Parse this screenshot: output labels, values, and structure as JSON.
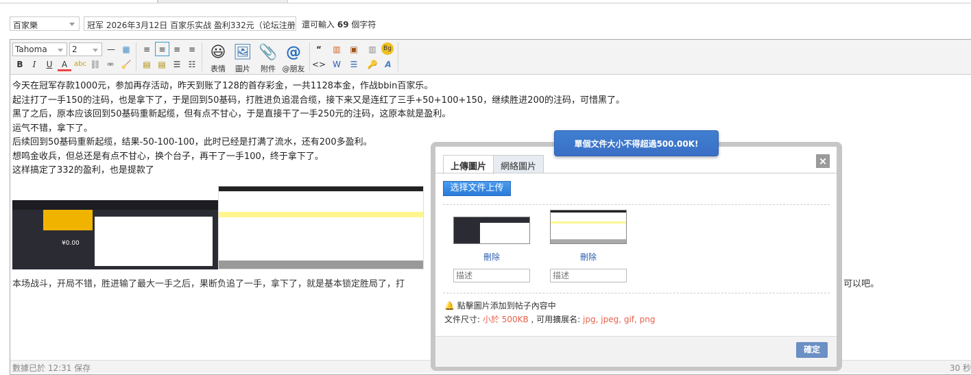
{
  "form": {
    "category": "百家樂",
    "title_value": "冠军 2026年3月12日 百家乐实战 盈利332元（论坛注册）",
    "counter_prefix": "還可輸入",
    "counter_num": "69",
    "counter_suffix": "個字符"
  },
  "toolbar": {
    "font": "Tahoma",
    "size": "2",
    "emoji": "表情",
    "image": "圖片",
    "attach": "附件",
    "at": "@朋友"
  },
  "content": {
    "paragraphs": [
      "今天在冠军存款1000元，参加再存活动，昨天到账了128的首存彩金，一共1128本金，作战bbin百家乐。",
      "起注打了一手150的注码，也是拿下了，于是回到50基码，打胜进负追混合缆，接下来又是连红了三手+50+100+150，继续胜进200的注码，可惜黑了。",
      "黑了之后，原本应该回到50基码重新起缆，但有点不甘心，于是直接干了一手250元的注码，这原本就是盈利。",
      "运气不错，拿下了。",
      "后续回到50基码重新起缆，结果-50-100-100，此时已经是打满了流水，还有200多盈利。",
      "想鸣金收兵，但总还是有点不甘心，换个台子，再干了一手100，终于拿下了。",
      "这样搞定了332的盈利，也是提款了"
    ],
    "last_left": "本场战斗，开局不错，胜进输了最大一手之后，果断负追了一手，拿下了，就是基本锁定胜局了，打",
    "last_right": "可以吧。",
    "img1_balance": "¥0.00"
  },
  "status": {
    "saved": "數據已於 12:31 保存",
    "right": "30 秒"
  },
  "dialog": {
    "toast": "單個文件大小不得超過500.00K!",
    "tab_upload": "上傳圖片",
    "tab_web": "網絡圖片",
    "close": "×",
    "upload_btn": "选择文件上传",
    "delete": "刪除",
    "desc_placeholder": "描述",
    "hint": "點擊圖片添加到帖子內容中",
    "size_label": "文件尺寸:",
    "size_value": "小於 500KB",
    "ext_label": ", 可用擴展名:",
    "ext_value": "jpg, jpeg, gif, png",
    "ok": "確定"
  },
  "colors": {
    "toast": "#3a75c8",
    "ok": "#6c8fc4",
    "hint": "#e8604c"
  }
}
